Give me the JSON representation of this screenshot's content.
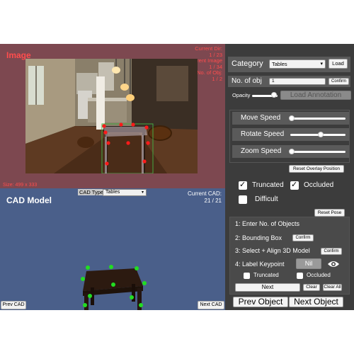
{
  "image_panel": {
    "title": "Image",
    "dir_lines": [
      "Current Dir:",
      "1 / 23",
      "Current Image",
      "1 / 34",
      "No. of Obj:",
      "1 / 2"
    ],
    "size_label": "Size: 499 x 333"
  },
  "cad_panel": {
    "title": "CAD Model",
    "cad_type_label": "CAD Type",
    "cad_type_value": "Tables",
    "current_cad_label": "Current CAD:",
    "current_cad_value": "21 / 21",
    "prev_label": "Prev CAD",
    "next_label": "Next CAD"
  },
  "controls": {
    "category_label": "Category",
    "category_value": "Tables",
    "load_label": "Load",
    "num_obj_label": "No. of obj",
    "num_obj_value": "1",
    "confirm_label": "Confirm",
    "opacity_label": "Opacity",
    "opacity_value": 0.85,
    "load_annotation_label": "Load Annotation",
    "move_speed_label": "Move Speed",
    "move_speed_value": 0.02,
    "rotate_speed_label": "Rotate Speed",
    "rotate_speed_value": 0.55,
    "zoom_speed_label": "Zoom Speed",
    "zoom_speed_value": 0.02,
    "reset_overlay_label": "Reset Overlay Position",
    "truncated_label": "Truncated",
    "truncated_checked": true,
    "occluded_label": "Occluded",
    "occluded_checked": true,
    "difficult_label": "Difficult",
    "difficult_checked": false,
    "reset_pose_label": "Reset Pose"
  },
  "steps": {
    "step1": "1:  Enter No. of Objects",
    "step2": "2:  Bounding Box",
    "step2_button": "Confirm",
    "step3": "3:  Select + Align 3D Model",
    "step3_button": "Confirm",
    "step4": "4:  Label Keypoint",
    "keypoint_value": "Nil",
    "kp_truncated_label": "Truncated",
    "kp_occluded_label": "Occluded",
    "next_label": "Next",
    "clear_label": "Clear",
    "clear_all_label": "Clear All"
  },
  "footer": {
    "prev_object_label": "Prev Object",
    "next_object_label": "Next Object"
  },
  "colors": {
    "image_bg": "#7d4850",
    "cad_bg": "#4a5f8a",
    "panel_bg": "#3c3c3c",
    "accent_red": "#ff4d4d",
    "keypoint_red": "#ff1a1a",
    "keypoint_green": "#22dd22"
  }
}
